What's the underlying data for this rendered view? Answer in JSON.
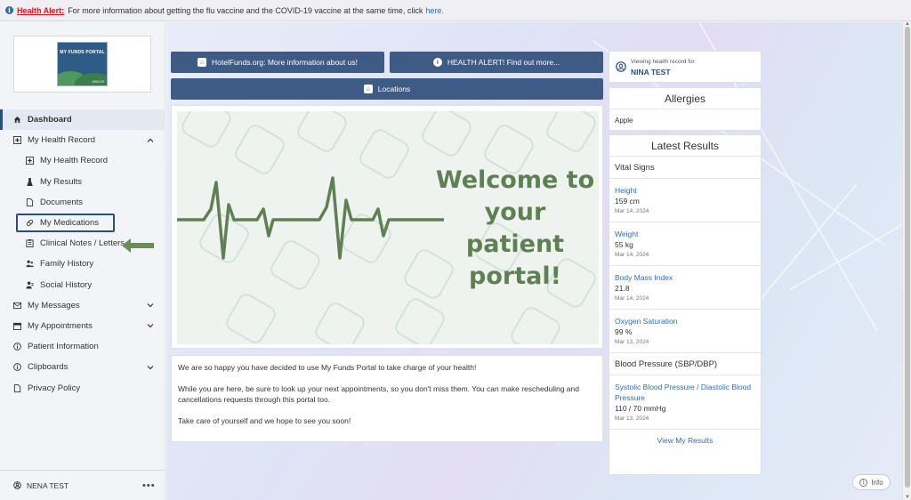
{
  "alert": {
    "title": "Health Alert:",
    "message": "For more information about getting the flu vaccine and the COVID-19 vaccine at the same time, click",
    "link": "here."
  },
  "logo": {
    "text": "MY FUNDS PORTAL",
    "sub": "HEALTH"
  },
  "sidebar": {
    "items": [
      {
        "label": "Dashboard",
        "icon": "home-icon"
      },
      {
        "label": "My Health Record",
        "icon": "health-record-icon"
      },
      {
        "label": "My Health Record",
        "icon": "health-record-icon"
      },
      {
        "label": "My Results",
        "icon": "flask-icon"
      },
      {
        "label": "Documents",
        "icon": "document-icon"
      },
      {
        "label": "My Medications",
        "icon": "pill-icon"
      },
      {
        "label": "Clinical Notes / Letters",
        "icon": "notes-icon"
      },
      {
        "label": "Family History",
        "icon": "family-icon"
      },
      {
        "label": "Social History",
        "icon": "social-icon"
      },
      {
        "label": "My Messages",
        "icon": "mail-icon"
      },
      {
        "label": "My Appointments",
        "icon": "calendar-icon"
      },
      {
        "label": "Patient Information",
        "icon": "info-icon"
      },
      {
        "label": "Clipboards",
        "icon": "info-icon"
      },
      {
        "label": "Privacy Policy",
        "icon": "document-icon"
      }
    ],
    "footer_user": "NENA TEST"
  },
  "buttons": {
    "hotelfunds": "HotelFunds.org: More information about us!",
    "health_alert": "HEALTH ALERT! Find out more...",
    "locations": "Locations"
  },
  "welcome": {
    "line1": "Welcome to",
    "line2": "your patient",
    "line3": "portal!"
  },
  "message": {
    "p1": "We are so happy you have decided to use My Funds Portal to take charge of your health!",
    "p2": "While you are here, be sure to look up your next appointments, so you don't miss them. You can make rescheduling and cancellations requests through this portal too.",
    "p3": "Take care of yourself and we hope to see you soon!"
  },
  "viewing": {
    "label": "Viewing health record for",
    "name": "NINA TEST"
  },
  "allergies": {
    "title": "Allergies",
    "items": [
      "Apple"
    ]
  },
  "results": {
    "title": "Latest Results",
    "vital_signs_heading": "Vital Signs",
    "vitals": [
      {
        "name": "Height",
        "value": "159 cm",
        "date": "Mar 14, 2024"
      },
      {
        "name": "Weight",
        "value": "55 kg",
        "date": "Mar 14, 2024"
      },
      {
        "name": "Body Mass Index",
        "value": "21.8",
        "date": "Mar 14, 2024"
      },
      {
        "name": "Oxygen Saturation",
        "value": "99 %",
        "date": "Mar 13, 2024"
      }
    ],
    "bp_heading": "Blood Pressure (SBP/DBP)",
    "bp": {
      "name": "Systolic Blood Pressure / Diastolic Blood Pressure",
      "value": "110 / 70 mmHg",
      "date": "Mar 13, 2024"
    },
    "view_link": "View My Results"
  },
  "info_button": "Info",
  "colors": {
    "primary": "#3d5b85",
    "link": "#2c6fb5",
    "alert": "#d11a1a",
    "welcome_green": "#5f8053"
  }
}
